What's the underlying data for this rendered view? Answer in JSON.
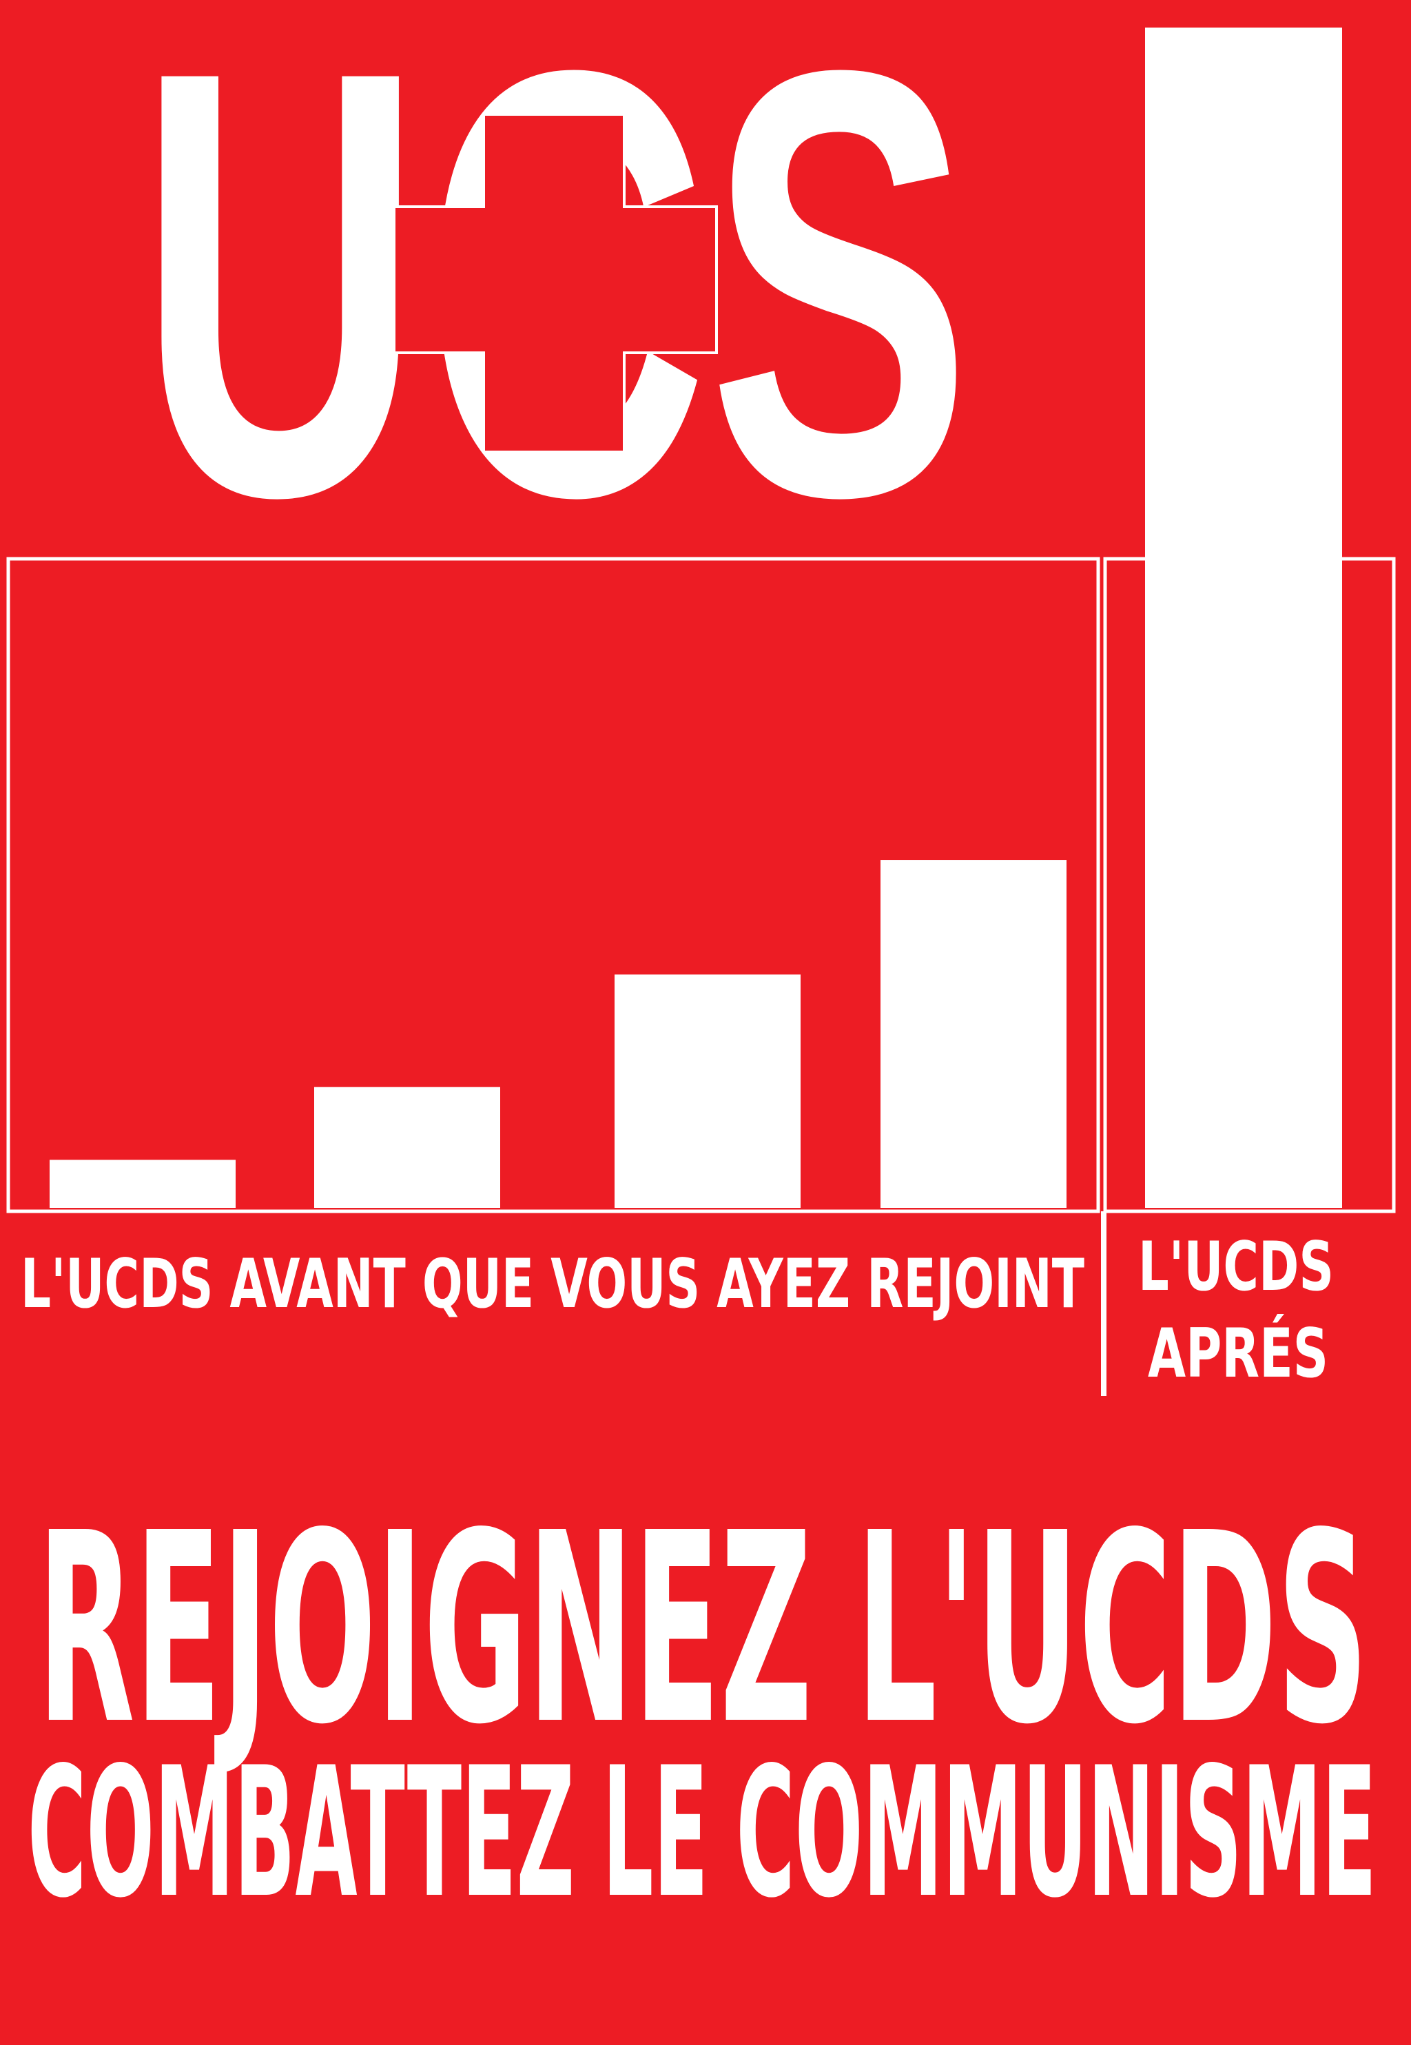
{
  "logo": {
    "text": "UCS"
  },
  "chart_data": {
    "type": "bar",
    "categories": [
      "",
      "",
      "",
      "",
      ""
    ],
    "values": [
      70,
      176,
      340,
      507,
      1720
    ],
    "ylim": [
      0,
      1720
    ],
    "grid": false,
    "captions": {
      "before": "L'UCDS AVANT QUE VOUS AYEZ REJOINT",
      "after_line1": "L'UCDS",
      "after_line2": "APRÉS"
    }
  },
  "slogan": {
    "line1": "REJOIGNEZ L'UCDS",
    "line2": "COMBATTEZ LE COMMUNISME"
  },
  "colors": {
    "background": "#ed1c24",
    "foreground": "#ffffff"
  }
}
